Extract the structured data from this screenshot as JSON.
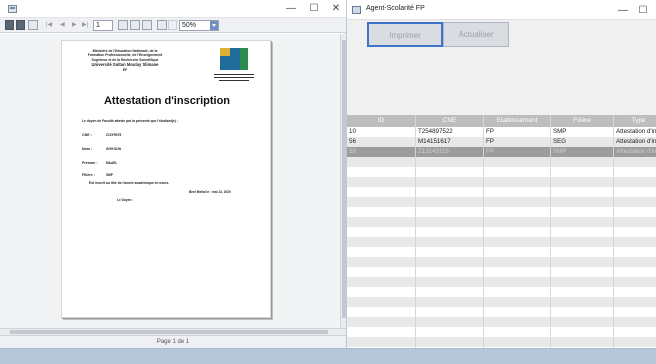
{
  "report_window": {
    "toolbar": {
      "page_input": "1",
      "zoom": "50%"
    },
    "status": "Page 1 de 1",
    "document": {
      "header_lines": [
        "Ministère de l'Education Nationale, de la",
        "Formation Professionnelle, de l'Enseignement",
        "Supérieur et de la Recherche Scientifique",
        "Université Sultan Moulay Slimane",
        "EF"
      ],
      "title": "Attestation d'inscription",
      "intro": "Le doyen de Faculté atteste par la présente que l'étudiant(e) :",
      "fields": [
        {
          "label": "CNE :",
          "value": "Z13YR076"
        },
        {
          "label": "Nom :",
          "value": "GHIYOUN"
        },
        {
          "label": "Prénom :",
          "value": "MAAEL"
        },
        {
          "label": "Filière :",
          "value": "SMP"
        }
      ],
      "certification": "Est inscrit au titre de l'année académique en cours.",
      "date_line": "Beni Mellal le :    mai 13, 2020",
      "signature": "Le Doyen :"
    }
  },
  "form_window": {
    "title": "Agent-Scolarité FP",
    "buttons": {
      "print": "Imprimer",
      "refresh": "Actualiser"
    },
    "table": {
      "columns": [
        "ID",
        "CNE",
        "Etablissement",
        "Filière",
        "Type"
      ],
      "rows": [
        [
          "10",
          "T254897522",
          "FP",
          "SMP",
          "Attestation d'ins"
        ],
        [
          "56",
          "M14151617",
          "FP",
          "SEG",
          "Attestation d'ins"
        ],
        [
          "58",
          "Z13143116",
          "FP",
          "SMP",
          "Attestation d'ins"
        ]
      ]
    }
  },
  "window_controls": {
    "minimize": "—",
    "maximize": "☐",
    "close": "✕"
  }
}
